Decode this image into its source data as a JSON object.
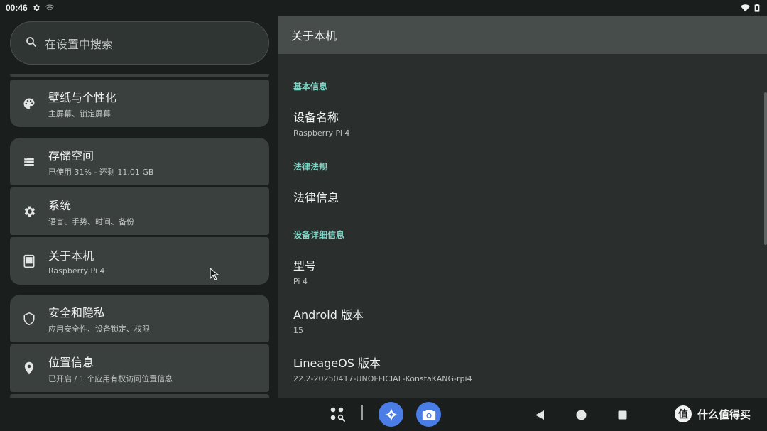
{
  "status_bar": {
    "time": "00:46",
    "icons_left": [
      "gear-icon",
      "signal-icon"
    ],
    "icons_right": [
      "wifi-icon",
      "battery-icon"
    ]
  },
  "search": {
    "placeholder": "在设置中搜索",
    "icon": "search-icon"
  },
  "settings_list": [
    {
      "icon": "palette-icon",
      "title": "壁纸与个性化",
      "subtitle": "主屏幕、锁定屏幕"
    },
    {
      "icon": "storage-icon",
      "title": "存储空间",
      "subtitle": "已使用 31% - 还剩 11.01 GB"
    },
    {
      "icon": "gear-icon",
      "title": "系统",
      "subtitle": "语言、手势、时间、备份"
    },
    {
      "icon": "tablet-icon",
      "title": "关于本机",
      "subtitle": "Raspberry Pi 4"
    },
    {
      "icon": "shield-icon",
      "title": "安全和隐私",
      "subtitle": "应用安全性、设备锁定、权限"
    },
    {
      "icon": "location-pin-icon",
      "title": "位置信息",
      "subtitle": "已开启 / 1 个应用有权访问位置信息"
    }
  ],
  "detail": {
    "title": "关于本机",
    "sections": [
      {
        "header": "基本信息",
        "items": [
          {
            "title": "设备名称",
            "summary": "Raspberry Pi 4"
          }
        ]
      },
      {
        "header": "法律法规",
        "items": [
          {
            "title": "法律信息",
            "summary": ""
          }
        ]
      },
      {
        "header": "设备详细信息",
        "items": [
          {
            "title": "型号",
            "summary": "Pi 4"
          },
          {
            "title": "Android 版本",
            "summary": "15"
          },
          {
            "title": "LineageOS 版本",
            "summary": "22.2-20250417-UNOFFICIAL-KonstaKANG-rpi4"
          }
        ]
      }
    ]
  },
  "nav_bar": {
    "icons": [
      "app-grid-search-icon",
      "assistant-icon",
      "camera-icon",
      "back-icon",
      "home-icon",
      "recents-icon"
    ]
  },
  "watermark": {
    "text": "什么值得买",
    "logo_text": "值"
  },
  "colors": {
    "accent": "#7fd6c6",
    "card_bg": "#3a403e",
    "detail_bg": "#2a2f2d",
    "appbar_bg": "#474d4b",
    "assistant_blue": "#4a7de6"
  }
}
